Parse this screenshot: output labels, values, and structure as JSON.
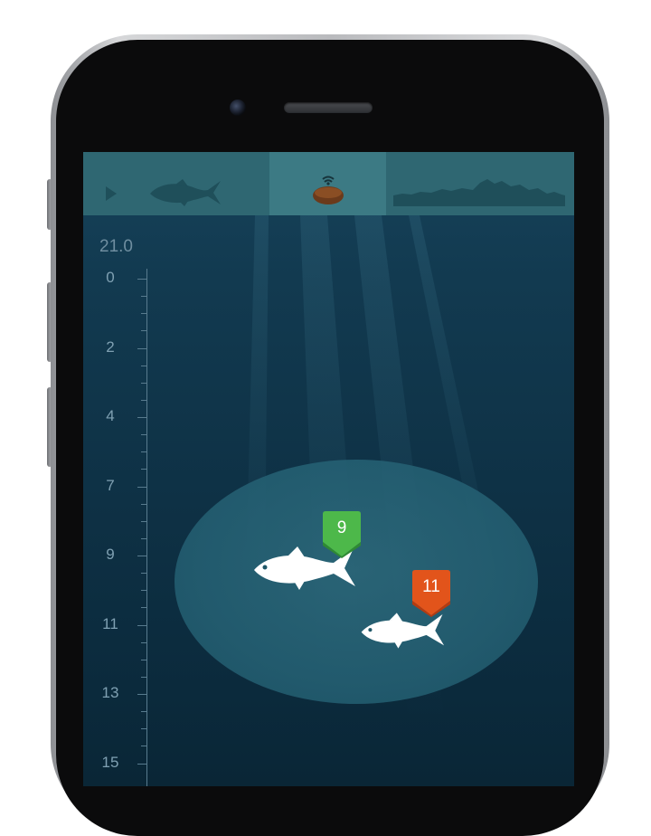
{
  "device": {
    "camera_icon": "camera-icon",
    "speaker_icon": "speaker-grille-icon"
  },
  "tabs": [
    {
      "name": "fish",
      "icon": "fish-icon",
      "active": false
    },
    {
      "name": "sonar",
      "icon": "sonar-device-icon",
      "active": true
    },
    {
      "name": "bottom-profile",
      "icon": "bottom-profile-icon",
      "active": false
    }
  ],
  "water_temperature": "21.0",
  "depth_scale": [
    "0",
    "2",
    "4",
    "7",
    "9",
    "11",
    "13",
    "15"
  ],
  "fish_markers": [
    {
      "depth_label": "9",
      "color": "#4db84a"
    },
    {
      "depth_label": "11",
      "color": "#e2541b"
    }
  ],
  "colors": {
    "screen_top": "#16425a",
    "screen_bottom": "#0a2636",
    "tab_bar": "#2f6772",
    "tab_active": "#3c7a84",
    "fish": "#ffffff"
  }
}
